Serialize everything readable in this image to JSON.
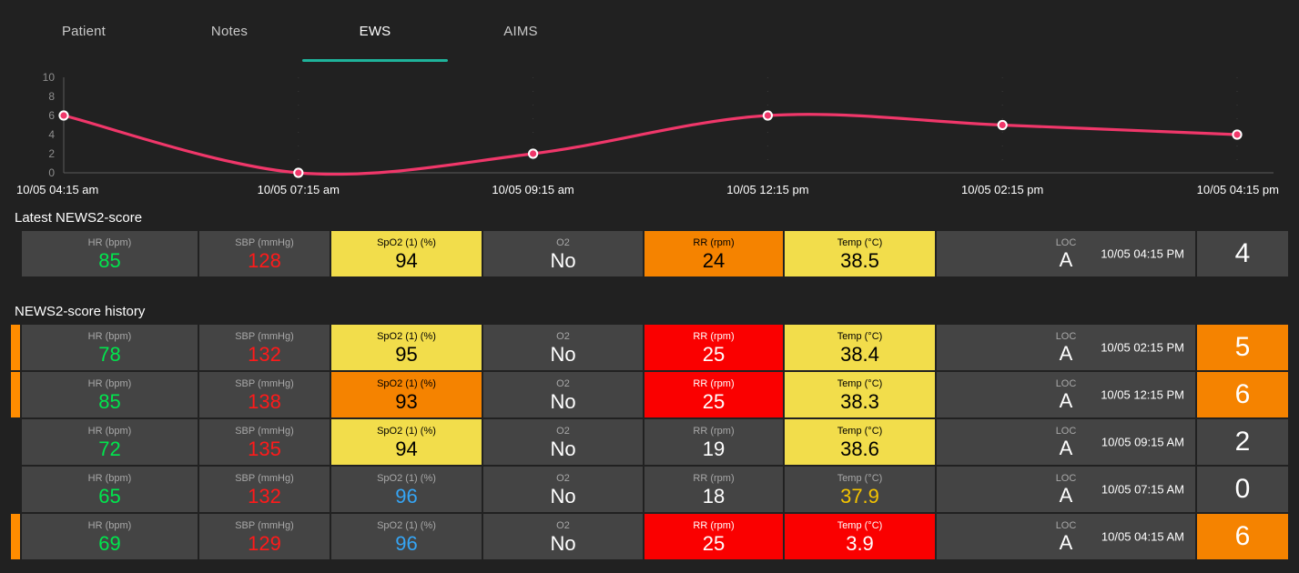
{
  "tabs": [
    {
      "label": "Patient",
      "active": false
    },
    {
      "label": "Notes",
      "active": false
    },
    {
      "label": "EWS",
      "active": true
    },
    {
      "label": "AIMS",
      "active": false
    }
  ],
  "accent_color": "#1fb39b",
  "chart_data": {
    "type": "line",
    "title": "",
    "xlabel": "",
    "ylabel": "",
    "ylim": [
      0,
      10
    ],
    "yticks": [
      0,
      2,
      4,
      6,
      8,
      10
    ],
    "grid": false,
    "line_color": "#f0376a",
    "point_fill": "#f0376a",
    "point_stroke": "#ffffff",
    "categories": [
      "10/05 04:15 am",
      "10/05 07:15 am",
      "10/05 09:15 am",
      "10/05 12:15 pm",
      "10/05 02:15 pm",
      "10/05 04:15 pm"
    ],
    "values": [
      6,
      0,
      2,
      6,
      5,
      4
    ],
    "series": [
      {
        "name": "NEWS2 score",
        "values": [
          6,
          0,
          2,
          6,
          5,
          4
        ]
      }
    ]
  },
  "latest": {
    "title": "Latest NEWS2-score",
    "row": {
      "indicator": false,
      "timestamp": "10/05 04:15 PM",
      "score": "4",
      "score_bg": "#444444",
      "score_color": "#ffffff",
      "cells": [
        {
          "label": "HR (bpm)",
          "value": "85",
          "bg": "#444444",
          "color": "#00e64d"
        },
        {
          "label": "SBP (mmHg)",
          "value": "128",
          "bg": "#444444",
          "color": "#ff1a1a"
        },
        {
          "label": "SpO2 (1) (%)",
          "value": "94",
          "bg": "#f2dd4b",
          "color": "#000000"
        },
        {
          "label": "O2",
          "value": "No",
          "bg": "#444444",
          "color": "#ffffff"
        },
        {
          "label": "RR (rpm)",
          "value": "24",
          "bg": "#f58300",
          "color": "#000000"
        },
        {
          "label": "Temp (°C)",
          "value": "38.5",
          "bg": "#f2dd4b",
          "color": "#000000"
        },
        {
          "label": "LOC",
          "value": "A",
          "bg": "#444444",
          "color": "#ffffff"
        }
      ]
    }
  },
  "history": {
    "title": "NEWS2-score history",
    "rows": [
      {
        "indicator": true,
        "timestamp": "10/05 02:15 PM",
        "score": "5",
        "score_bg": "#f58300",
        "score_color": "#ffffff",
        "cells": [
          {
            "label": "HR (bpm)",
            "value": "78",
            "bg": "#444444",
            "color": "#00e64d"
          },
          {
            "label": "SBP (mmHg)",
            "value": "132",
            "bg": "#444444",
            "color": "#ff1a1a"
          },
          {
            "label": "SpO2 (1) (%)",
            "value": "95",
            "bg": "#f2dd4b",
            "color": "#000000"
          },
          {
            "label": "O2",
            "value": "No",
            "bg": "#444444",
            "color": "#ffffff"
          },
          {
            "label": "RR (rpm)",
            "value": "25",
            "bg": "#fa0000",
            "color": "#ffffff"
          },
          {
            "label": "Temp (°C)",
            "value": "38.4",
            "bg": "#f2dd4b",
            "color": "#000000"
          },
          {
            "label": "LOC",
            "value": "A",
            "bg": "#444444",
            "color": "#ffffff"
          }
        ]
      },
      {
        "indicator": true,
        "timestamp": "10/05 12:15 PM",
        "score": "6",
        "score_bg": "#f58300",
        "score_color": "#ffffff",
        "cells": [
          {
            "label": "HR (bpm)",
            "value": "85",
            "bg": "#444444",
            "color": "#00e64d"
          },
          {
            "label": "SBP (mmHg)",
            "value": "138",
            "bg": "#444444",
            "color": "#ff1a1a"
          },
          {
            "label": "SpO2 (1) (%)",
            "value": "93",
            "bg": "#f58300",
            "color": "#000000"
          },
          {
            "label": "O2",
            "value": "No",
            "bg": "#444444",
            "color": "#ffffff"
          },
          {
            "label": "RR (rpm)",
            "value": "25",
            "bg": "#fa0000",
            "color": "#ffffff"
          },
          {
            "label": "Temp (°C)",
            "value": "38.3",
            "bg": "#f2dd4b",
            "color": "#000000"
          },
          {
            "label": "LOC",
            "value": "A",
            "bg": "#444444",
            "color": "#ffffff"
          }
        ]
      },
      {
        "indicator": false,
        "timestamp": "10/05 09:15 AM",
        "score": "2",
        "score_bg": "#444444",
        "score_color": "#ffffff",
        "cells": [
          {
            "label": "HR (bpm)",
            "value": "72",
            "bg": "#444444",
            "color": "#00e64d"
          },
          {
            "label": "SBP (mmHg)",
            "value": "135",
            "bg": "#444444",
            "color": "#ff1a1a"
          },
          {
            "label": "SpO2 (1) (%)",
            "value": "94",
            "bg": "#f2dd4b",
            "color": "#000000"
          },
          {
            "label": "O2",
            "value": "No",
            "bg": "#444444",
            "color": "#ffffff"
          },
          {
            "label": "RR (rpm)",
            "value": "19",
            "bg": "#444444",
            "color": "#ffffff"
          },
          {
            "label": "Temp (°C)",
            "value": "38.6",
            "bg": "#f2dd4b",
            "color": "#000000"
          },
          {
            "label": "LOC",
            "value": "A",
            "bg": "#444444",
            "color": "#ffffff"
          }
        ]
      },
      {
        "indicator": false,
        "timestamp": "10/05 07:15 AM",
        "score": "0",
        "score_bg": "#444444",
        "score_color": "#ffffff",
        "cells": [
          {
            "label": "HR (bpm)",
            "value": "65",
            "bg": "#444444",
            "color": "#00e64d"
          },
          {
            "label": "SBP (mmHg)",
            "value": "132",
            "bg": "#444444",
            "color": "#ff1a1a"
          },
          {
            "label": "SpO2 (1) (%)",
            "value": "96",
            "bg": "#444444",
            "color": "#35a5f5"
          },
          {
            "label": "O2",
            "value": "No",
            "bg": "#444444",
            "color": "#ffffff"
          },
          {
            "label": "RR (rpm)",
            "value": "18",
            "bg": "#444444",
            "color": "#ffffff"
          },
          {
            "label": "Temp (°C)",
            "value": "37.9",
            "bg": "#444444",
            "color": "#f5c400"
          },
          {
            "label": "LOC",
            "value": "A",
            "bg": "#444444",
            "color": "#ffffff"
          }
        ]
      },
      {
        "indicator": true,
        "timestamp": "10/05 04:15 AM",
        "score": "6",
        "score_bg": "#f58300",
        "score_color": "#ffffff",
        "cells": [
          {
            "label": "HR (bpm)",
            "value": "69",
            "bg": "#444444",
            "color": "#00e64d"
          },
          {
            "label": "SBP (mmHg)",
            "value": "129",
            "bg": "#444444",
            "color": "#ff1a1a"
          },
          {
            "label": "SpO2 (1) (%)",
            "value": "96",
            "bg": "#444444",
            "color": "#35a5f5"
          },
          {
            "label": "O2",
            "value": "No",
            "bg": "#444444",
            "color": "#ffffff"
          },
          {
            "label": "RR (rpm)",
            "value": "25",
            "bg": "#fa0000",
            "color": "#ffffff"
          },
          {
            "label": "Temp (°C)",
            "value": "3.9",
            "bg": "#fa0000",
            "color": "#ffffff"
          },
          {
            "label": "LOC",
            "value": "A",
            "bg": "#444444",
            "color": "#ffffff"
          }
        ]
      }
    ]
  }
}
